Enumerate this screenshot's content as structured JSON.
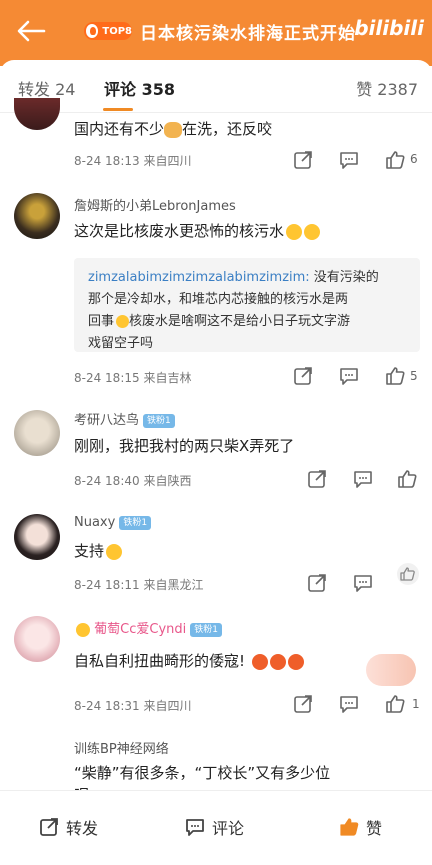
{
  "header": {
    "hot_badge": "TOP8",
    "title": "日本核污染水排海正式开始",
    "logo": "bilibili"
  },
  "tabs": {
    "repost": "转发 24",
    "comments": "评论 358",
    "likes": "赞 2387"
  },
  "comments": [
    {
      "text": "国内还有不少  在洗，还反咬",
      "text_a": "国内还有不少",
      "text_b": "在洗，还反咬",
      "meta": "8-24 18:13  来自四川",
      "likes": "6"
    },
    {
      "user": "詹姆斯的小弟LebronJames",
      "text": "这次是比核废水更恐怖的核污水",
      "quote": {
        "name": "zimzalabimzimzimzalabimzimzim:",
        "line1": " 没有污染的",
        "line2": "那个是冷却水，和堆芯内芯接触的核污水是两",
        "line3a": "回事",
        "line3b": "核废水是啥啊这不是给小日子玩文字游",
        "line4": "戏留空子吗"
      },
      "meta": "8-24 18:15  来自吉林",
      "likes": "5"
    },
    {
      "user": "考研八达鸟",
      "level": "铁粉1",
      "text": "刚刚，我把我村的两只柴X弄死了",
      "meta": "8-24 18:40  来自陕西"
    },
    {
      "user": "Nuaxy",
      "level": "铁粉1",
      "text": "支持",
      "meta": "8-24 18:11  来自黑龙江"
    },
    {
      "user": "葡萄Cc爱Cyndi",
      "level": "铁粉1",
      "text": "自私自利扭曲畸形的倭寇!",
      "meta": "8-24 18:31  来自四川",
      "likes": "1"
    },
    {
      "user": "训练BP神经网络",
      "text": "“柴静”有很多条，“丁校长”又有多少位",
      "text2": "呢"
    }
  ],
  "bottom": {
    "repost": "转发",
    "comment": "评论",
    "like": "赞"
  },
  "colors": {
    "brand": "#f58a34",
    "accent": "#f08a24",
    "link": "#3b7fc4"
  }
}
